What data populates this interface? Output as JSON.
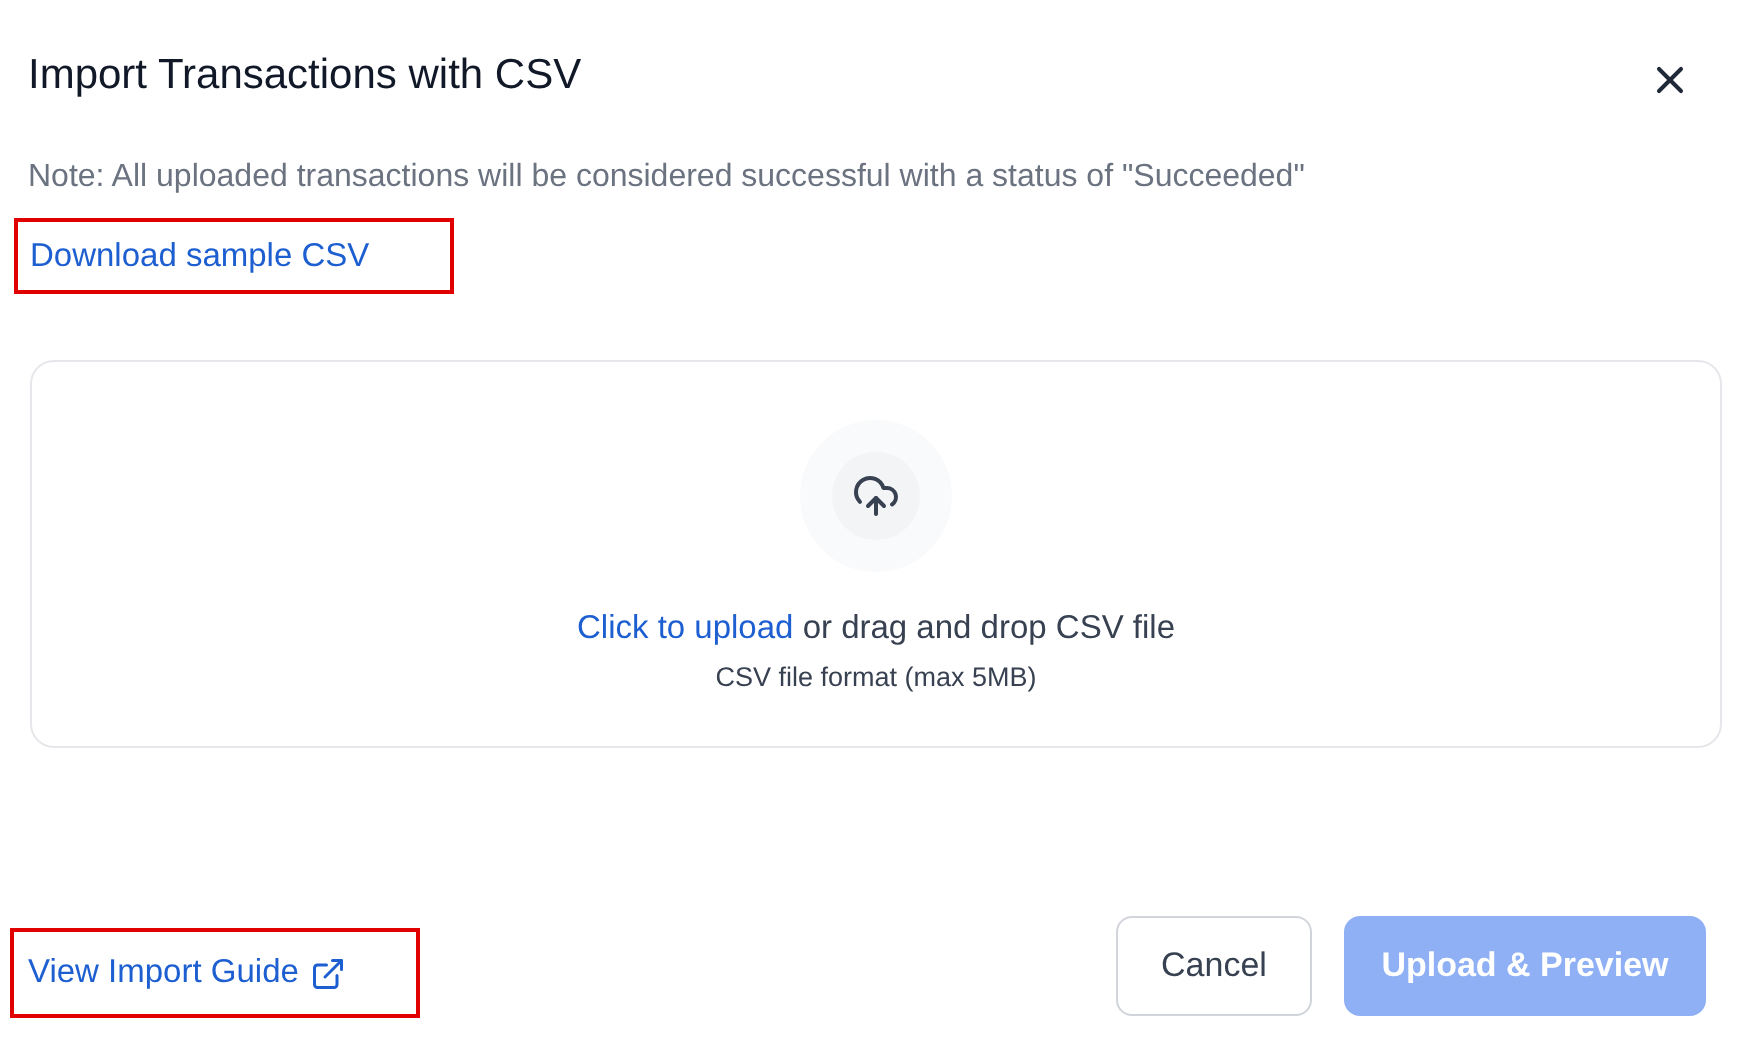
{
  "dialog": {
    "title": "Import Transactions with CSV",
    "note": "Note: All uploaded transactions will be considered successful with a status of \"Succeeded\"",
    "sample_link": {
      "label": "Download sample CSV",
      "highlighted": true
    }
  },
  "dropzone": {
    "link": "Click to upload",
    "text": "or drag and drop CSV file",
    "hint": "CSV file format (max 5MB)"
  },
  "footer": {
    "guide_link": {
      "label": "View Import Guide",
      "highlighted": true
    },
    "buttons": [
      {
        "kind": "secondary",
        "label": "Cancel",
        "disabled": false
      },
      {
        "kind": "primary",
        "label": "Upload & Preview",
        "disabled": true
      }
    ]
  }
}
